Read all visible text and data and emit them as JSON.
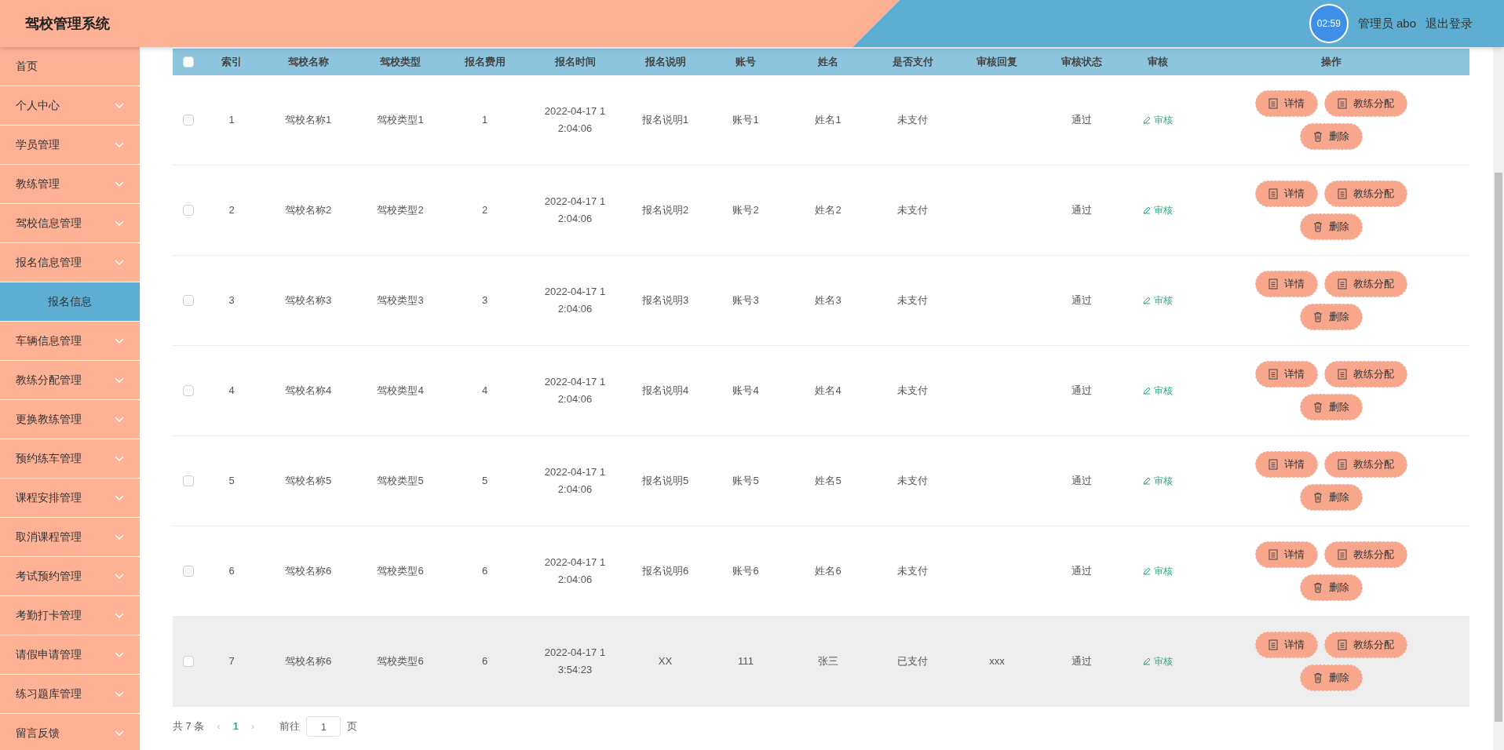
{
  "header": {
    "title": "驾校管理系统",
    "clock": "02:59",
    "user": "管理员 abo",
    "logout": "退出登录"
  },
  "sidebar": {
    "items": [
      {
        "label": "首页",
        "expandable": false,
        "selected": false
      },
      {
        "label": "个人中心",
        "expandable": true,
        "selected": false
      },
      {
        "label": "学员管理",
        "expandable": true,
        "selected": false
      },
      {
        "label": "教练管理",
        "expandable": true,
        "selected": false
      },
      {
        "label": "驾校信息管理",
        "expandable": true,
        "selected": false
      },
      {
        "label": "报名信息管理",
        "expandable": true,
        "selected": false,
        "children": [
          {
            "label": "报名信息",
            "selected": true
          }
        ]
      },
      {
        "label": "车辆信息管理",
        "expandable": true,
        "selected": false
      },
      {
        "label": "教练分配管理",
        "expandable": true,
        "selected": false
      },
      {
        "label": "更换教练管理",
        "expandable": true,
        "selected": false
      },
      {
        "label": "预约练车管理",
        "expandable": true,
        "selected": false
      },
      {
        "label": "课程安排管理",
        "expandable": true,
        "selected": false
      },
      {
        "label": "取消课程管理",
        "expandable": true,
        "selected": false
      },
      {
        "label": "考试预约管理",
        "expandable": true,
        "selected": false
      },
      {
        "label": "考勤打卡管理",
        "expandable": true,
        "selected": false
      },
      {
        "label": "请假申请管理",
        "expandable": true,
        "selected": false
      },
      {
        "label": "练习题库管理",
        "expandable": true,
        "selected": false
      },
      {
        "label": "留言反馈",
        "expandable": true,
        "selected": false
      }
    ]
  },
  "table": {
    "select_all_checked": false,
    "columns": [
      "索引",
      "驾校名称",
      "驾校类型",
      "报名费用",
      "报名时间",
      "报名说明",
      "账号",
      "姓名",
      "是否支付",
      "审核回复",
      "审核状态",
      "审核",
      "操作"
    ],
    "rows": [
      {
        "checked": false,
        "hovered": false,
        "cells": [
          "1",
          "驾校名称1",
          "驾校类型1",
          "1",
          "2022-04-17 12:04:06",
          "报名说明1",
          "账号1",
          "姓名1",
          "未支付",
          "",
          "通过"
        ],
        "review": "审核",
        "actions": [
          {
            "kind": "doc",
            "label": "详情"
          },
          {
            "kind": "doc",
            "label": "教练分配"
          },
          {
            "kind": "trash",
            "label": "删除"
          }
        ]
      },
      {
        "checked": false,
        "hovered": false,
        "cells": [
          "2",
          "驾校名称2",
          "驾校类型2",
          "2",
          "2022-04-17 12:04:06",
          "报名说明2",
          "账号2",
          "姓名2",
          "未支付",
          "",
          "通过"
        ],
        "review": "审核",
        "actions": [
          {
            "kind": "doc",
            "label": "详情"
          },
          {
            "kind": "doc",
            "label": "教练分配"
          },
          {
            "kind": "trash",
            "label": "删除"
          }
        ]
      },
      {
        "checked": false,
        "hovered": false,
        "cells": [
          "3",
          "驾校名称3",
          "驾校类型3",
          "3",
          "2022-04-17 12:04:06",
          "报名说明3",
          "账号3",
          "姓名3",
          "未支付",
          "",
          "通过"
        ],
        "review": "审核",
        "actions": [
          {
            "kind": "doc",
            "label": "详情"
          },
          {
            "kind": "doc",
            "label": "教练分配"
          },
          {
            "kind": "trash",
            "label": "删除"
          }
        ]
      },
      {
        "checked": false,
        "hovered": false,
        "cells": [
          "4",
          "驾校名称4",
          "驾校类型4",
          "4",
          "2022-04-17 12:04:06",
          "报名说明4",
          "账号4",
          "姓名4",
          "未支付",
          "",
          "通过"
        ],
        "review": "审核",
        "actions": [
          {
            "kind": "doc",
            "label": "详情"
          },
          {
            "kind": "doc",
            "label": "教练分配"
          },
          {
            "kind": "trash",
            "label": "删除"
          }
        ]
      },
      {
        "checked": false,
        "hovered": false,
        "cells": [
          "5",
          "驾校名称5",
          "驾校类型5",
          "5",
          "2022-04-17 12:04:06",
          "报名说明5",
          "账号5",
          "姓名5",
          "未支付",
          "",
          "通过"
        ],
        "review": "审核",
        "actions": [
          {
            "kind": "doc",
            "label": "详情"
          },
          {
            "kind": "doc",
            "label": "教练分配"
          },
          {
            "kind": "trash",
            "label": "删除"
          }
        ]
      },
      {
        "checked": false,
        "hovered": false,
        "cells": [
          "6",
          "驾校名称6",
          "驾校类型6",
          "6",
          "2022-04-17 12:04:06",
          "报名说明6",
          "账号6",
          "姓名6",
          "未支付",
          "",
          "通过"
        ],
        "review": "审核",
        "actions": [
          {
            "kind": "doc",
            "label": "详情"
          },
          {
            "kind": "doc",
            "label": "教练分配"
          },
          {
            "kind": "trash",
            "label": "删除"
          }
        ]
      },
      {
        "checked": false,
        "hovered": true,
        "cells": [
          "7",
          "驾校名称6",
          "驾校类型6",
          "6",
          "2022-04-17 13:54:23",
          "XX",
          "111",
          "张三",
          "已支付",
          "xxx",
          "通过"
        ],
        "review": "审核",
        "actions": [
          {
            "kind": "doc",
            "label": "详情"
          },
          {
            "kind": "doc",
            "label": "教练分配"
          },
          {
            "kind": "trash",
            "label": "删除"
          }
        ]
      }
    ]
  },
  "pagination": {
    "total": "共 7 条",
    "prev": "‹",
    "pages": [
      {
        "label": "1",
        "selected": true
      }
    ],
    "next": "›",
    "goto": "前往",
    "page_value": "1",
    "page_unit": "页"
  }
}
